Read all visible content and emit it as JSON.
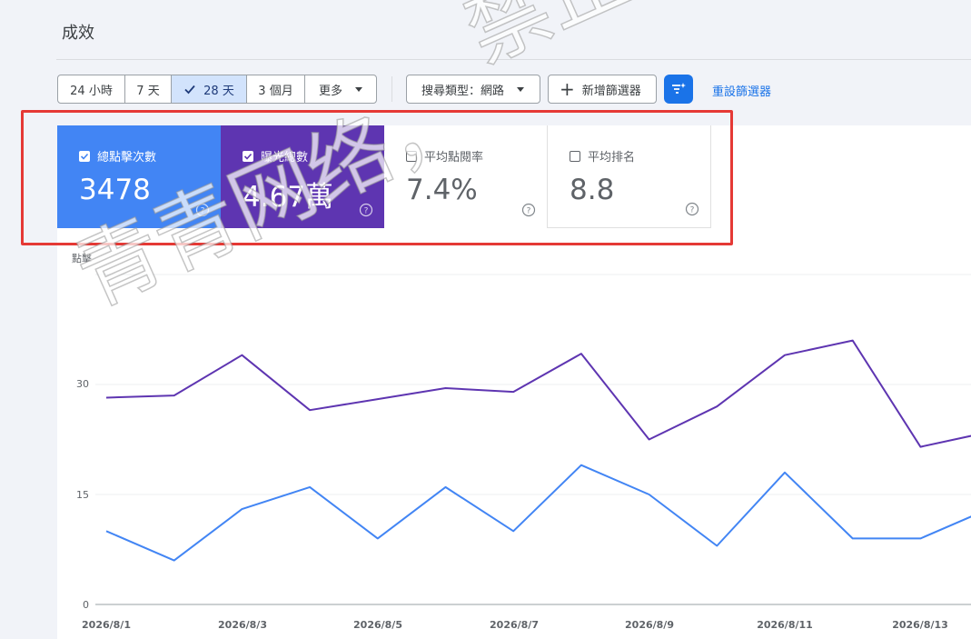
{
  "page": {
    "title": "成效"
  },
  "date_range": {
    "options": [
      {
        "label": "24 小時",
        "active": false
      },
      {
        "label": "7 天",
        "active": false
      },
      {
        "label": "28 天",
        "active": true
      },
      {
        "label": "3 個月",
        "active": false
      },
      {
        "label": "更多",
        "active": false
      }
    ]
  },
  "filters": {
    "search_type": "搜尋類型：網路",
    "add_filter": "新增篩選器",
    "reset": "重設篩選器"
  },
  "metrics": [
    {
      "label": "總點擊次數",
      "value": "3478",
      "checked": true,
      "color": "#4285f4"
    },
    {
      "label": "曝光總數",
      "value": "4.67萬",
      "checked": true,
      "color": "#5e35b1"
    },
    {
      "label": "平均點閱率",
      "value": "7.4%",
      "checked": false,
      "color": "#ffffff"
    },
    {
      "label": "平均排名",
      "value": "8.8",
      "checked": false,
      "color": "#ffffff"
    }
  ],
  "watermark": "青青网络，禁止盗图",
  "chart_data": {
    "type": "line",
    "ylabel": "點擊",
    "yticks": [
      "0",
      "15",
      "30"
    ],
    "ylim": [
      0,
      48
    ],
    "xticks": [
      "2026/8/1",
      "2026/8/3",
      "2026/8/5",
      "2026/8/7",
      "2026/8/9",
      "2026/8/11",
      "2026/8/13"
    ],
    "x": [
      "2026/8/1",
      "2026/8/2",
      "2026/8/3",
      "2026/8/4",
      "2026/8/5",
      "2026/8/6",
      "2026/8/7",
      "2026/8/8",
      "2026/8/9",
      "2026/8/10",
      "2026/8/11",
      "2026/8/12",
      "2026/8/13",
      "2026/8/14"
    ],
    "series": [
      {
        "metric": "曝光總數",
        "color": "#5e35b1",
        "values": [
          28.2,
          28.5,
          34,
          26.5,
          28,
          29.5,
          29,
          34.2,
          22.5,
          27,
          34,
          36,
          21.5,
          23.5
        ]
      },
      {
        "metric": "總點擊次數",
        "color": "#4285f4",
        "values": [
          10,
          6,
          13,
          16,
          9,
          16,
          10,
          19,
          15,
          8,
          18,
          9,
          9,
          13
        ]
      }
    ],
    "grid": true
  }
}
